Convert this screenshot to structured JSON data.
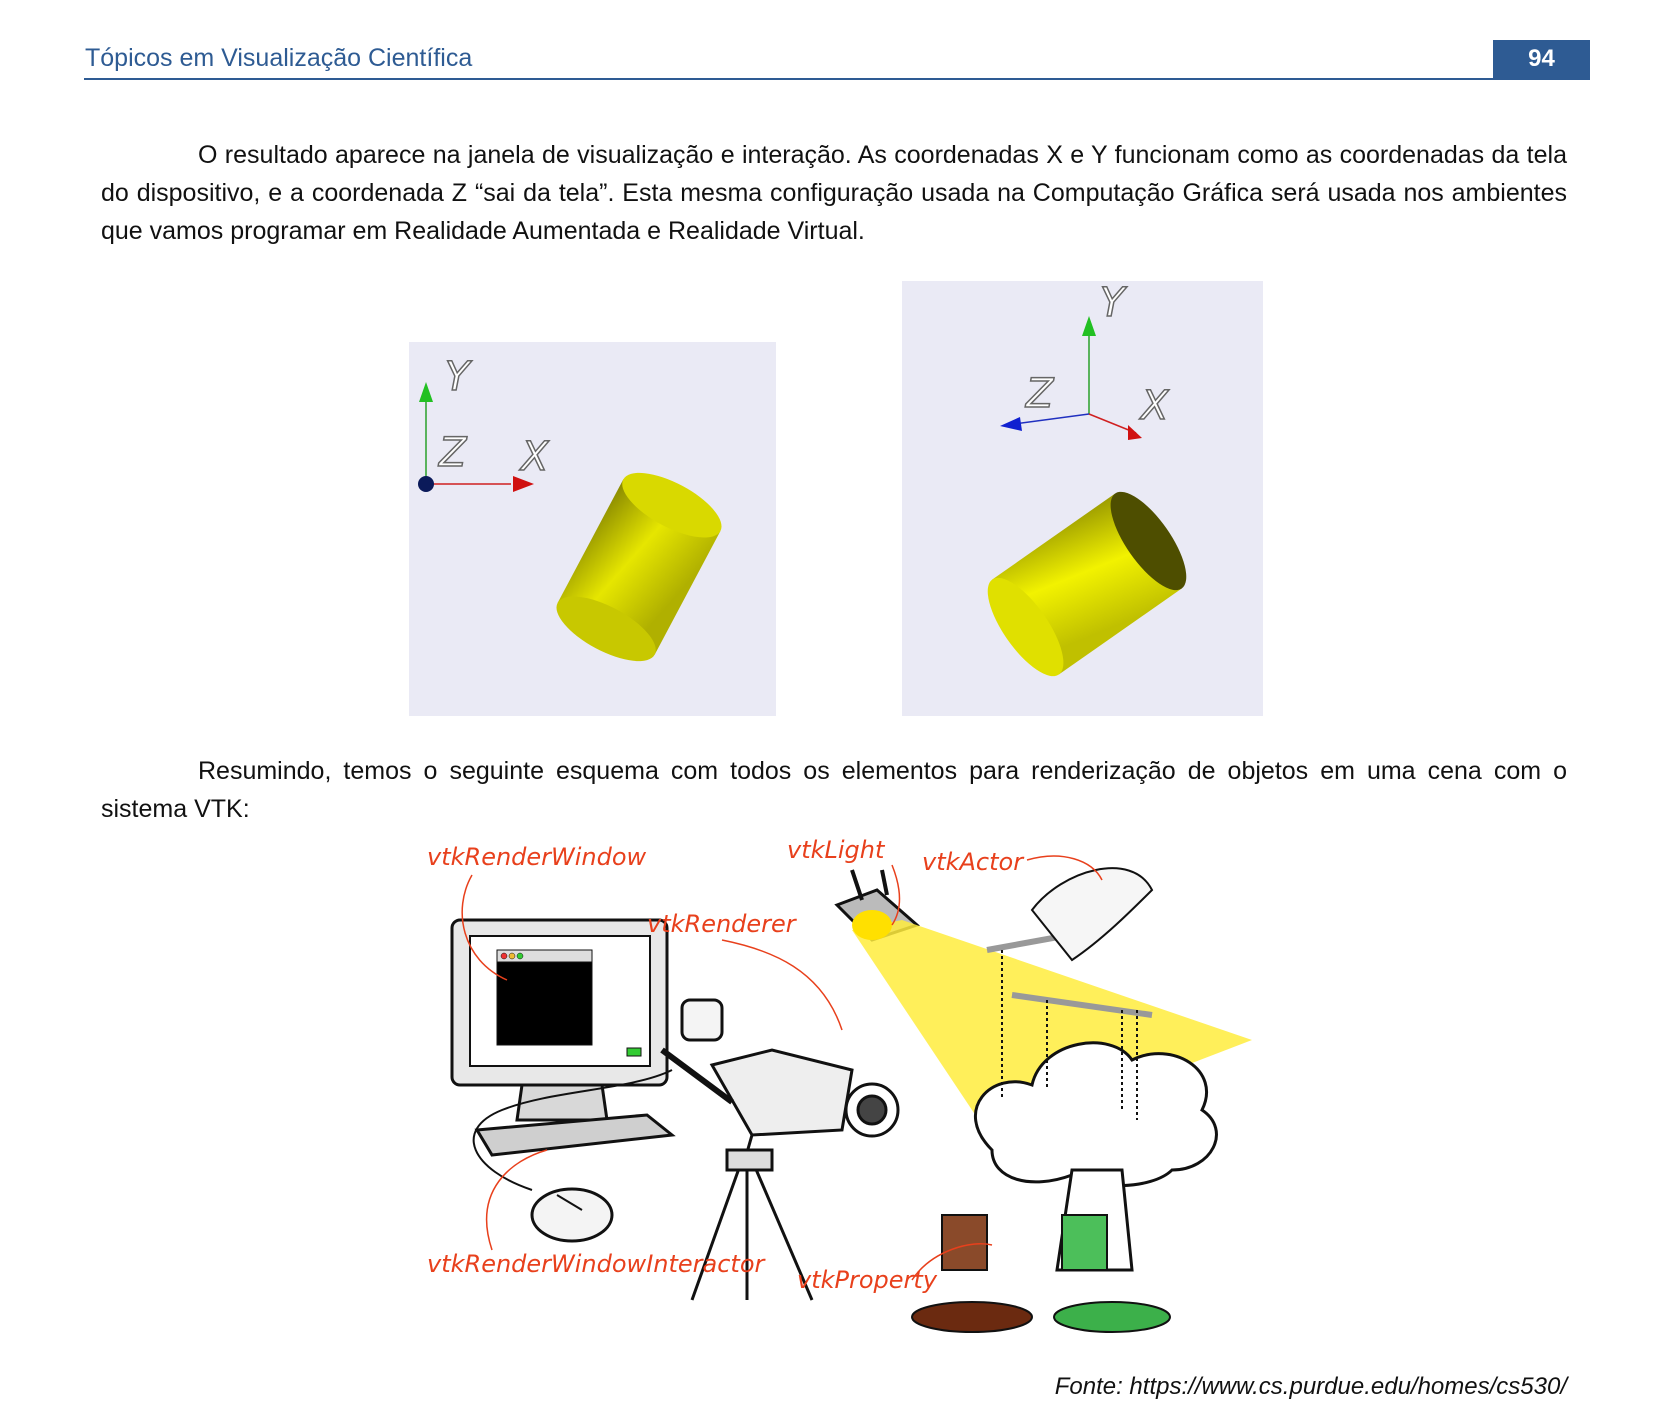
{
  "header": {
    "title": "Tópicos em Visualização Científica",
    "page_number": "94"
  },
  "paragraphs": {
    "p1": "O resultado aparece na janela de visualização e interação. As coordenadas X e Y funcionam como as coordenadas da tela do dispositivo, e a coordenada Z “sai da tela”. Esta mesma configuração usada na Computação Gráfica será usada nos ambientes que vamos programar em Realidade Aumentada e Realidade Virtual.",
    "p2": "Resumindo, temos o seguinte esquema com todos os elementos para renderização de objetos em uma cena com o sistema VTK:"
  },
  "render_left": {
    "axis_x": "X",
    "axis_y": "Y",
    "axis_z": "Z"
  },
  "render_right": {
    "axis_x": "X",
    "axis_y": "Y",
    "axis_z": "Z"
  },
  "diagram": {
    "labels": {
      "render_window": "vtkRenderWindow",
      "light": "vtkLight",
      "actor": "vtkActor",
      "renderer": "vtkRenderer",
      "interactor": "vtkRenderWindowInteractor",
      "property": "vtkProperty"
    },
    "label_color": "#e8401c"
  },
  "source": "Fonte: https://www.cs.purdue.edu/homes/cs530/",
  "colors": {
    "accent": "#2e5b93",
    "cylinder": "#e8e800",
    "render_bg": "#eaeaf5"
  }
}
